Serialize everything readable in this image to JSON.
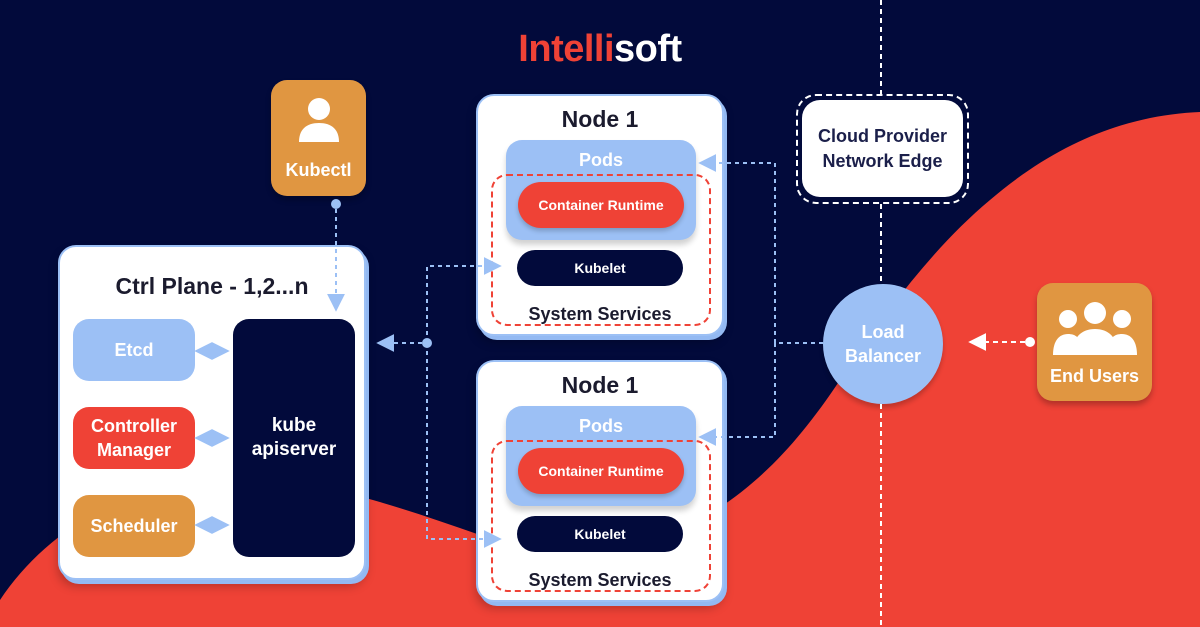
{
  "brand": {
    "part1": "Intelli",
    "part2": "soft"
  },
  "colors": {
    "background": "#020a3b",
    "accent_red": "#ef4236",
    "accent_orange": "#e09641",
    "accent_blue": "#9cc0f5",
    "white": "#ffffff"
  },
  "kubectl": {
    "label": "Kubectl",
    "icon": "user-icon"
  },
  "control_plane": {
    "title": "Ctrl Plane - 1,2...n",
    "components": [
      {
        "label": "Etcd"
      },
      {
        "label": "Controller Manager",
        "line1": "Controller",
        "line2": "Manager"
      },
      {
        "label": "Scheduler"
      }
    ],
    "apiserver": {
      "line1": "kube",
      "line2": "apiserver"
    }
  },
  "nodes": [
    {
      "title": "Node 1",
      "pods": "Pods",
      "runtime": "Container Runtime",
      "kubelet": "Kubelet",
      "services": "System Services"
    },
    {
      "title": "Node 1",
      "pods": "Pods",
      "runtime": "Container Runtime",
      "kubelet": "Kubelet",
      "services": "System Services"
    }
  ],
  "cloud_edge": {
    "line1": "Cloud Provider",
    "line2": "Network Edge"
  },
  "load_balancer": {
    "line1": "Load",
    "line2": "Balancer"
  },
  "end_users": {
    "label": "End Users",
    "icon": "users-group-icon"
  }
}
